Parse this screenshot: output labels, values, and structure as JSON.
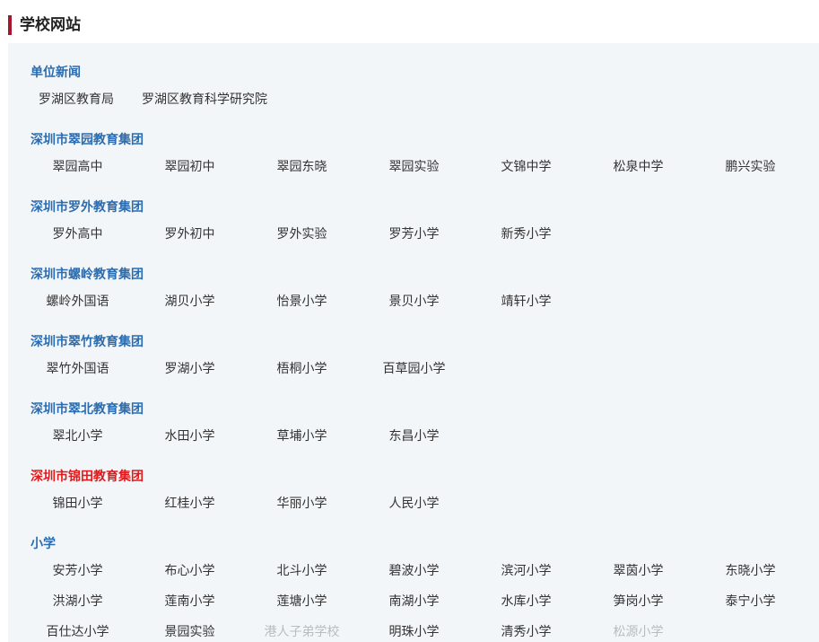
{
  "header": {
    "title": "学校网站"
  },
  "colors": {
    "accent_bar": "#a5162f",
    "section_blue": "#2b6cb0",
    "section_red": "#e0191b",
    "panel_bg": "#f3f6f9"
  },
  "sections": [
    {
      "title": "单位新闻",
      "items": [
        "罗湖区教育局",
        "罗湖区教育科学研究院"
      ]
    },
    {
      "title": "深圳市翠园教育集团",
      "items": [
        "翠园高中",
        "翠园初中",
        "翠园东晓",
        "翠园实验",
        "文锦中学",
        "松泉中学",
        "鹏兴实验"
      ]
    },
    {
      "title": "深圳市罗外教育集团",
      "items": [
        "罗外高中",
        "罗外初中",
        "罗外实验",
        "罗芳小学",
        "新秀小学"
      ]
    },
    {
      "title": "深圳市螺岭教育集团",
      "items": [
        "螺岭外国语",
        "湖贝小学",
        "怡景小学",
        "景贝小学",
        "靖轩小学"
      ]
    },
    {
      "title": "深圳市翠竹教育集团",
      "items": [
        "翠竹外国语",
        "罗湖小学",
        "梧桐小学",
        "百草园小学"
      ]
    },
    {
      "title": "深圳市翠北教育集团",
      "items": [
        "翠北小学",
        "水田小学",
        "草埔小学",
        "东昌小学"
      ]
    },
    {
      "title": "深圳市锦田教育集团",
      "items": [
        "锦田小学",
        "红桂小学",
        "华丽小学",
        "人民小学"
      ]
    },
    {
      "title": "小学",
      "items": [
        "安芳小学",
        "布心小学",
        "北斗小学",
        "碧波小学",
        "滨河小学",
        "翠茵小学",
        "东晓小学",
        "洪湖小学",
        "莲南小学",
        "莲塘小学",
        "南湖小学",
        "水库小学",
        "笋岗小学",
        "泰宁小学",
        "百仕达小学",
        "景园实验",
        "港人子弟学校",
        "明珠小学",
        "清秀小学",
        "松源小学"
      ]
    }
  ]
}
